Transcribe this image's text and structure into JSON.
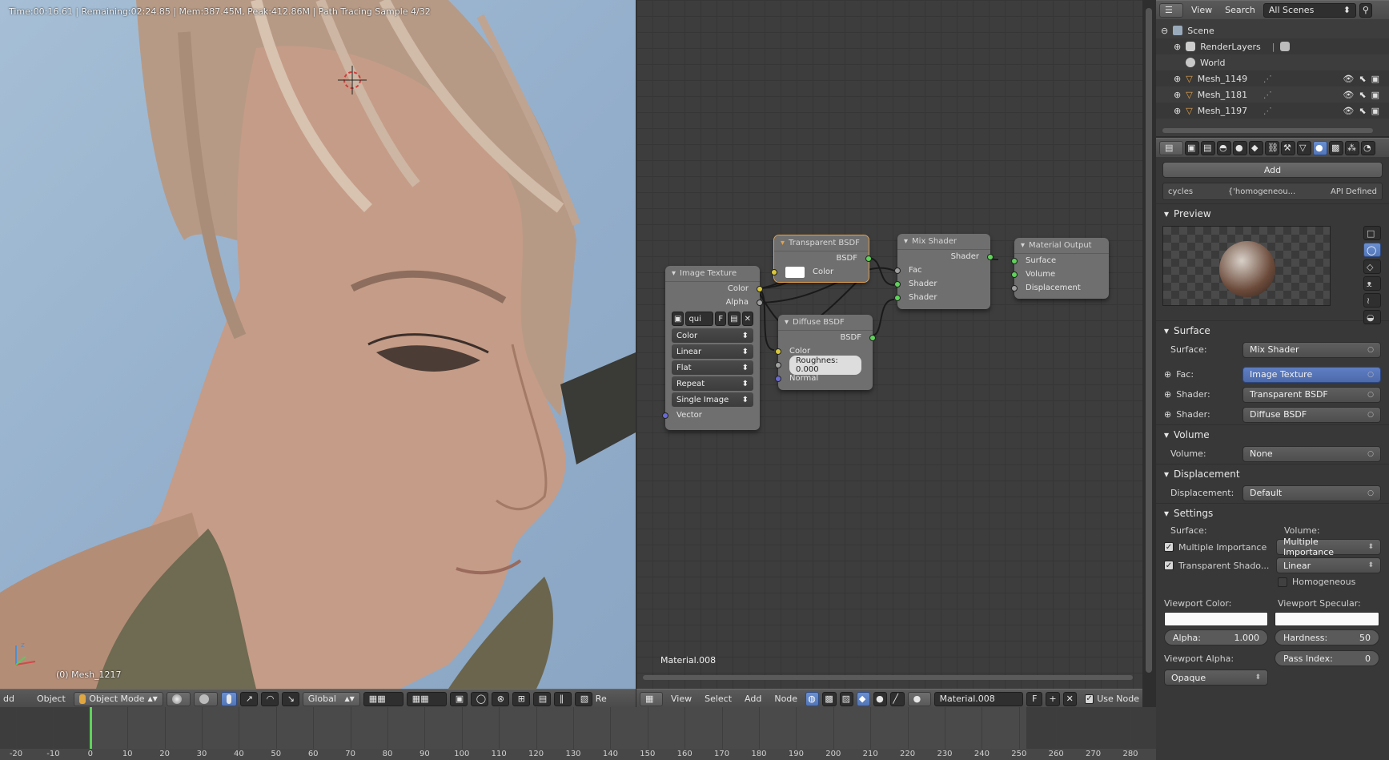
{
  "viewport": {
    "render_info": "Time:00:16.61 | Remaining:02:24.85 | Mem:387.45M, Peak:412.86M | Path Tracing Sample 4/32",
    "object_label": "(0) Mesh_1217",
    "header": {
      "menu_cut": "dd",
      "object_menu": "Object",
      "mode": "Object Mode",
      "orientation": "Global",
      "render_cut": "Re"
    }
  },
  "node_editor": {
    "nodes": {
      "image_texture": {
        "title": "Image Texture",
        "outputs": [
          "Color",
          "Alpha"
        ],
        "image_name": "qui",
        "fake_user": "F",
        "dropdowns": [
          "Color",
          "Linear",
          "Flat",
          "Repeat",
          "Single Image"
        ],
        "input": "Vector"
      },
      "transparent": {
        "title": "Transparent BSDF",
        "output": "BSDF",
        "input": "Color"
      },
      "diffuse": {
        "title": "Diffuse BSDF",
        "output": "BSDF",
        "inputs": [
          "Color",
          "Normal"
        ],
        "roughness": "Roughnes: 0.000"
      },
      "mix": {
        "title": "Mix Shader",
        "output": "Shader",
        "inputs": [
          "Fac",
          "Shader",
          "Shader"
        ]
      },
      "output": {
        "title": "Material Output",
        "inputs": [
          "Surface",
          "Volume",
          "Displacement"
        ]
      }
    },
    "material_label": "Material.008",
    "header": {
      "view": "View",
      "select": "Select",
      "add": "Add",
      "node": "Node",
      "material": "Material.008",
      "fake_user": "F",
      "use_nodes": "Use Node"
    }
  },
  "outliner": {
    "header": {
      "view": "View",
      "search": "Search",
      "scenes": "All Scenes"
    },
    "items": [
      {
        "name": "Scene",
        "icon": "scene-icon",
        "indent": 0
      },
      {
        "name": "RenderLayers",
        "icon": "renderlayers-icon",
        "indent": 1
      },
      {
        "name": "World",
        "icon": "world-icon",
        "indent": 1
      },
      {
        "name": "Mesh_1149",
        "icon": "mesh-icon",
        "indent": 1
      },
      {
        "name": "Mesh_1181",
        "icon": "mesh-icon",
        "indent": 1
      },
      {
        "name": "Mesh_1197",
        "icon": "mesh-icon",
        "indent": 1
      }
    ]
  },
  "properties": {
    "add_button": "Add",
    "cycles_row": {
      "engine": "cycles",
      "value": "{'homogeneou...",
      "source": "API Defined"
    },
    "preview": {
      "title": "Preview"
    },
    "surface": {
      "title": "Surface",
      "surface_label": "Surface:",
      "surface_value": "Mix Shader",
      "fac_label": "Fac:",
      "fac_value": "Image Texture",
      "shader1_label": "Shader:",
      "shader1_value": "Transparent BSDF",
      "shader2_label": "Shader:",
      "shader2_value": "Diffuse BSDF"
    },
    "volume": {
      "title": "Volume",
      "label": "Volume:",
      "value": "None"
    },
    "displacement": {
      "title": "Displacement",
      "label": "Displacement:",
      "value": "Default"
    },
    "settings": {
      "title": "Settings",
      "surface_label": "Surface:",
      "volume_label": "Volume:",
      "multiple_importance": "Multiple Importance",
      "transparent_shadows": "Transparent Shado...",
      "volume_sampling": "Multiple Importance",
      "volume_interp": "Linear",
      "homogeneous": "Homogeneous",
      "viewport_color": "Viewport Color:",
      "viewport_specular": "Viewport Specular:",
      "alpha": "Alpha:",
      "alpha_value": "1.000",
      "hardness": "Hardness:",
      "hardness_value": "50",
      "viewport_alpha": "Viewport Alpha:",
      "pass_index": "Pass Index:",
      "pass_index_value": "0",
      "blend": "Opaque"
    }
  },
  "timeline": {
    "ticks": [
      "-20",
      "-10",
      "0",
      "10",
      "20",
      "30",
      "40",
      "50",
      "60",
      "70",
      "80",
      "90",
      "100",
      "110",
      "120",
      "130",
      "140",
      "150",
      "160",
      "170",
      "180",
      "190",
      "200",
      "210",
      "220",
      "230",
      "240",
      "250",
      "260",
      "270",
      "280"
    ]
  },
  "colors": {
    "socket_yellow": "#d9c83b",
    "socket_gray": "#a0a0a0",
    "socket_green": "#5fd35a",
    "socket_blue": "#6a6ad0",
    "selection_orange": "#e3a24d",
    "field_blue": "#5676b8"
  }
}
